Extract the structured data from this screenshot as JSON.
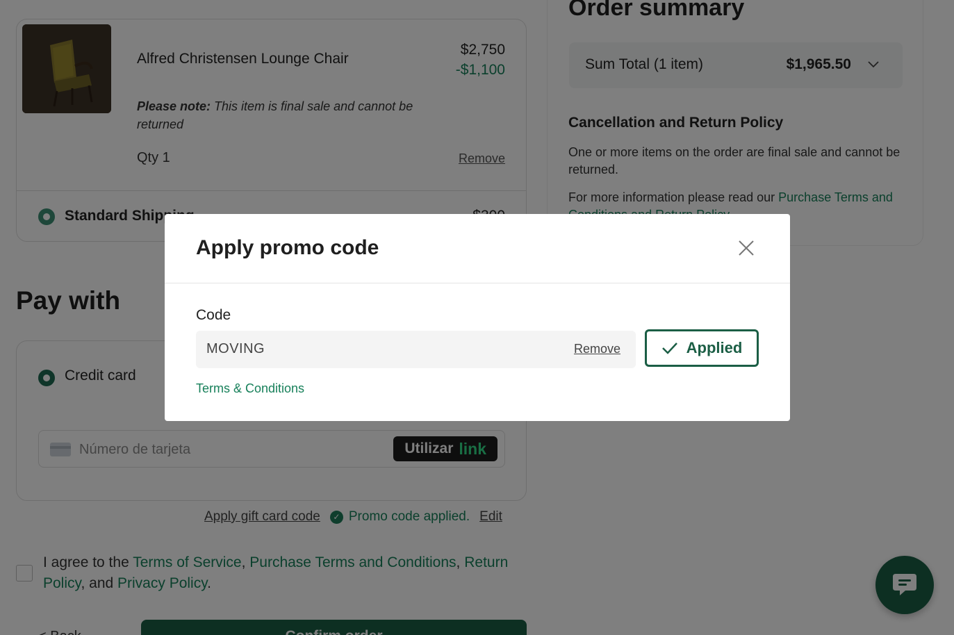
{
  "cart": {
    "product_name": "Alfred Christensen Lounge Chair",
    "price_original": "$2,750",
    "price_discount": "-$1,100",
    "note_bold": "Please note:",
    "note_text": " This item is final sale and cannot be returned",
    "qty": "Qty 1",
    "remove_label": "Remove",
    "shipping_label": "Standard Shipping",
    "shipping_price": "$300"
  },
  "payment": {
    "heading": "Pay with",
    "credit_card_label": "Credit card",
    "card_number_placeholder": "Número de tarjeta",
    "link_button_text": "Utilizar",
    "link_brand": "link"
  },
  "promo_row": {
    "gift_card_link": "Apply gift card code",
    "promo_status": "Promo code applied.",
    "edit_link": "Edit"
  },
  "agreement": {
    "prefix": "I agree to the ",
    "tos": "Terms of Service",
    "sep1": ", ",
    "purchase_terms": "Purchase Terms and Conditions",
    "sep2": ", ",
    "return_policy": "Return Policy",
    "sep3": ", and ",
    "privacy": "Privacy Policy",
    "suffix": "."
  },
  "actions": {
    "back_label": "< Back",
    "confirm_label": "Confirm order"
  },
  "summary": {
    "title": "Order summary",
    "sum_total_label": "Sum Total (1 item)",
    "sum_total_amount": "$1,965.50",
    "policy_heading": "Cancellation and Return Policy",
    "policy_text": "One or more items on the order are final sale and cannot be returned.",
    "policy_more_prefix": "For more information please read our ",
    "policy_more_link": "Purchase Terms and Conditions and Return Policy"
  },
  "modal": {
    "title": "Apply promo code",
    "code_label": "Code",
    "code_value": "MOVING",
    "remove_label": "Remove",
    "applied_label": "Applied",
    "terms_link": "Terms & Conditions"
  },
  "colors": {
    "brand_green": "#1b5e45",
    "link_green": "#17805a",
    "overlay": "rgba(0,0,0,0.5)"
  }
}
